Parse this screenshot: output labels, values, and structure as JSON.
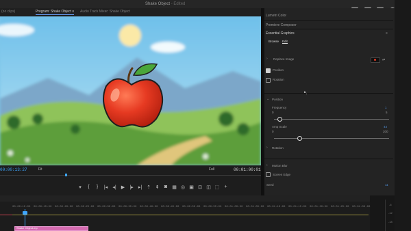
{
  "window": {
    "title": "Shake Object",
    "title_suffix": " - Edited"
  },
  "tabs": [
    {
      "label": "(no clips)"
    },
    {
      "label": "Program: Shake Object",
      "close": "≡"
    },
    {
      "label": "Audio Track Mixer: Shake Object"
    }
  ],
  "monitor": {
    "timecode_current": "00:00:13:27",
    "fit_label": "Fit",
    "resolution_label": "Full",
    "timecode_total": "00:01:00:01"
  },
  "transport": [
    {
      "icon": "marker-icon",
      "glyph": "▾"
    },
    {
      "icon": "mark-in-icon",
      "glyph": "{"
    },
    {
      "icon": "mark-out-icon",
      "glyph": "}"
    },
    {
      "icon": "go-to-in-icon",
      "glyph": "|◂"
    },
    {
      "icon": "step-back-icon",
      "glyph": "◂|"
    },
    {
      "icon": "play-icon",
      "glyph": "▶"
    },
    {
      "icon": "step-forward-icon",
      "glyph": "|▸"
    },
    {
      "icon": "go-to-out-icon",
      "glyph": "▸|"
    },
    {
      "icon": "lift-icon",
      "glyph": "⇡"
    },
    {
      "icon": "extract-icon",
      "glyph": "⇞"
    },
    {
      "icon": "camera-icon",
      "glyph": "◙"
    },
    {
      "icon": "multicam-icon",
      "glyph": "▦"
    },
    {
      "icon": "vr-icon",
      "glyph": "◎"
    },
    {
      "icon": "proxy-icon",
      "glyph": "▣"
    },
    {
      "icon": "safe-margins-icon",
      "glyph": "⊡"
    },
    {
      "icon": "compare-icon",
      "glyph": "◫"
    },
    {
      "icon": "export-frame-icon",
      "glyph": "⬚"
    },
    {
      "icon": "add-button-icon",
      "glyph": "+"
    }
  ],
  "panel": {
    "lumetri_color": "Lumetri Color",
    "premiere_composer": "Premiere Composer",
    "essential_graphics": "Essential Graphics",
    "menu_glyph": "≡",
    "browse": "Browse",
    "edit": "Edit",
    "replace_image": "Replace Image",
    "position": "Position",
    "rotation": "Rotation",
    "position_checked": true,
    "rotation_checked": false,
    "section_position": "Position",
    "frequency_label": "Frequency",
    "frequency_min": "0",
    "frequency_max": "5",
    "frequency_value": "1",
    "frequency_level": 0.05,
    "amplitude_label": "Amp Scale",
    "amplitude_min": "0",
    "amplitude_max": "200",
    "amplitude_value": "44",
    "amplitude_level": 0.22,
    "section_rotation": "Rotation",
    "section_motion_blur": "Motion Blur",
    "screen_edge": "Screen Edge",
    "screen_edge_checked": false,
    "seed": "Seed",
    "seed_value": "11"
  },
  "timeline": {
    "ruler": [
      "00:00:10:00",
      "00:00:15:00",
      "00:00:20:00",
      "00:00:25:00",
      "00:00:30:00",
      "00:00:35:00",
      "00:00:40:00",
      "00:00:45:00",
      "00:00:50:00",
      "00:00:55:00",
      "00:01:00:00",
      "00:01:05:00",
      "00:01:10:00",
      "00:01:15:00",
      "00:01:20:00",
      "00:01:25:00",
      "00:01:30:00"
    ],
    "clip_label": "Shake Object.mp",
    "meter_ticks": [
      "-6",
      "-12",
      "-18"
    ]
  },
  "colors": {
    "accent_blue": "#3ea6ff",
    "clip_pink": "#d46bb0",
    "apple_red": "#e63a22",
    "sky": "#7ec6ea",
    "grass": "#6ab04c"
  }
}
